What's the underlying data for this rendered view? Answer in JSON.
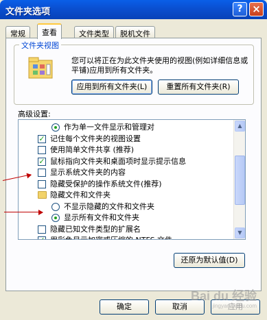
{
  "window": {
    "title": "文件夹选项",
    "help_glyph": "?",
    "close_glyph": "×"
  },
  "tabs": [
    {
      "label": "常规",
      "active": false
    },
    {
      "label": "查看",
      "active": true
    },
    {
      "label": "文件类型",
      "active": false
    },
    {
      "label": "脱机文件",
      "active": false
    }
  ],
  "folder_view": {
    "title": "文件夹视图",
    "description": "您可以将正在为此文件夹使用的视图(例如详细信息或平铺)应用到所有文件夹。",
    "apply_all_label": "应用到所有文件夹(L)",
    "reset_all_label": "重置所有文件夹(R)"
  },
  "advanced": {
    "label": "高级设置:",
    "items": [
      {
        "kind": "radio",
        "checked": true,
        "indent": 2,
        "label": "作为单一文件显示和管理对"
      },
      {
        "kind": "checkbox",
        "checked": true,
        "indent": 1,
        "label": "记住每个文件夹的视图设置"
      },
      {
        "kind": "checkbox",
        "checked": false,
        "indent": 1,
        "label": "使用简单文件共享 (推荐)"
      },
      {
        "kind": "checkbox",
        "checked": true,
        "indent": 1,
        "label": "鼠标指向文件夹和桌面项时显示提示信息"
      },
      {
        "kind": "checkbox",
        "checked": false,
        "indent": 1,
        "label": "显示系统文件夹的内容"
      },
      {
        "kind": "checkbox",
        "checked": false,
        "indent": 1,
        "label": "隐藏受保护的操作系统文件(推荐)"
      },
      {
        "kind": "folder",
        "checked": false,
        "indent": 1,
        "label": "隐藏文件和文件夹"
      },
      {
        "kind": "radio",
        "checked": false,
        "indent": 2,
        "label": "不显示隐藏的文件和文件夹"
      },
      {
        "kind": "radio",
        "checked": true,
        "indent": 2,
        "label": "显示所有文件和文件夹"
      },
      {
        "kind": "checkbox",
        "checked": false,
        "indent": 1,
        "label": "隐藏已知文件类型的扩展名"
      },
      {
        "kind": "checkbox",
        "checked": true,
        "indent": 1,
        "label": "用彩色显示加密或压缩的 NTFS 文件"
      }
    ]
  },
  "restore_defaults_label": "还原为默认值(D)",
  "footer": {
    "ok_label": "确定",
    "cancel_label": "取消",
    "apply_label": "应用"
  },
  "watermark": {
    "text": "Bai du 经验",
    "sub": "jingyan.baidu.com"
  },
  "colors": {
    "titlebar": "#0a4fd0",
    "accent": "#0046d5",
    "annotation_arrow": "#c00000",
    "check": "#21a121"
  }
}
